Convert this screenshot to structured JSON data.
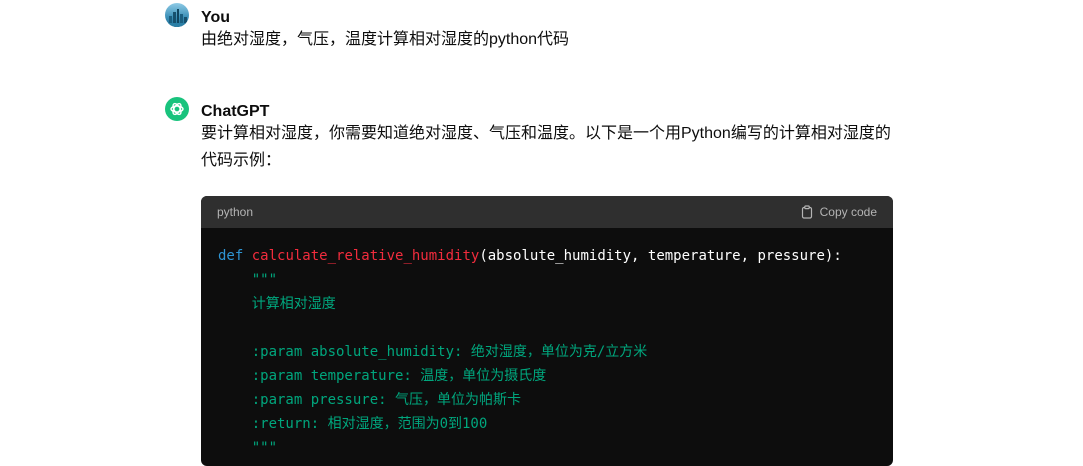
{
  "user": {
    "author": "You",
    "message": "由绝对湿度，气压，温度计算相对湿度的python代码"
  },
  "assistant": {
    "author": "ChatGPT",
    "message_line1": "要计算相对湿度，你需要知道绝对湿度、气压和温度。以下是一个用Python编写的计算相对湿度的",
    "message_line2": "代码示例："
  },
  "code_block": {
    "language": "python",
    "copy_label": "Copy code",
    "def_keyword": "def",
    "function_name": "calculate_relative_humidity",
    "signature_rest": "(absolute_humidity, temperature, pressure):",
    "docstring_lines": [
      "    \"\"\"",
      "    计算相对湿度",
      "",
      "    :param absolute_humidity: 绝对湿度，单位为克/立方米",
      "    :param temperature: 温度，单位为摄氏度",
      "    :param pressure: 气压，单位为帕斯卡",
      "    :return: 相对湿度，范围为0到100",
      "    \"\"\""
    ]
  },
  "colors": {
    "keyword": "#2e95d3",
    "function": "#f22c3d",
    "docstring": "#00a67d",
    "gpt_avatar": "#19c37d"
  }
}
